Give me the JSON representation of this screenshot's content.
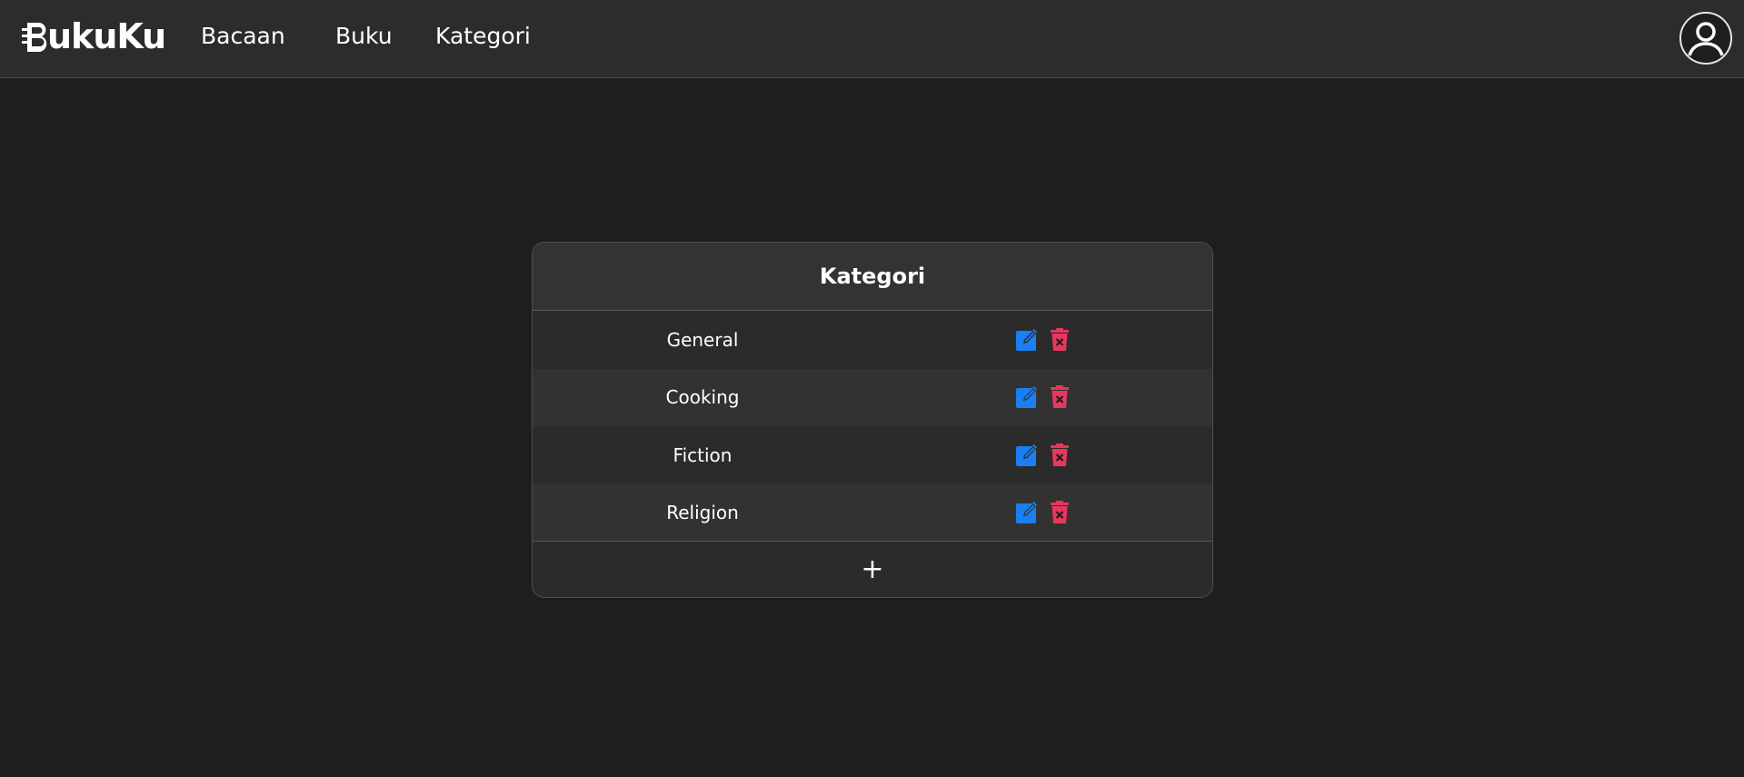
{
  "brand": {
    "name": "ukuKu"
  },
  "nav": {
    "items": [
      {
        "label": "Bacaan"
      },
      {
        "label": "Buku"
      },
      {
        "label": "Kategori"
      }
    ]
  },
  "user": {
    "icon": "user-avatar-icon"
  },
  "kategori": {
    "title": "Kategori",
    "rows": [
      {
        "name": "General"
      },
      {
        "name": "Cooking"
      },
      {
        "name": "Fiction"
      },
      {
        "name": "Religion"
      }
    ],
    "add_label": "+",
    "edit_icon": "edit-icon",
    "delete_icon": "trash-icon"
  },
  "colors": {
    "background": "#1e1e1e",
    "navbar": "#2c2c2c",
    "edit": "#1a7ff0",
    "delete": "#e8365d"
  }
}
